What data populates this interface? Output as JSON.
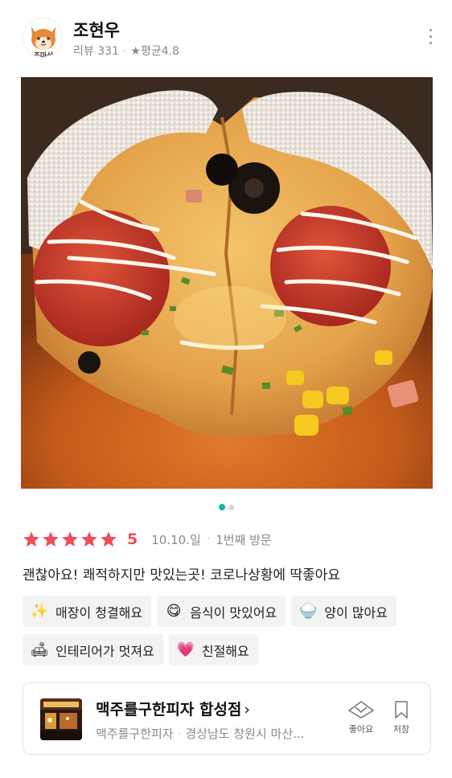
{
  "user": {
    "name": "조현우",
    "avatar_text": "조마산",
    "review_count_label": "리뷰 331",
    "avg_label": "★평균4.8"
  },
  "photo": {
    "pager_total": 2,
    "pager_active": 1
  },
  "review": {
    "stars": 5,
    "score": "5",
    "date": "10.10.일",
    "visit": "1번째 방문",
    "text": "괜찮아요! 쾌적하지만 맛있는곳! 코로나상황에 딱좋아요"
  },
  "tags": [
    {
      "icon": "sparkles-icon",
      "glyph": "✨",
      "label": "매장이 청결해요"
    },
    {
      "icon": "yum-face-icon",
      "glyph": "😋",
      "label": "음식이 맛있어요"
    },
    {
      "icon": "rice-bowl-icon",
      "glyph": "🍚",
      "label": "양이 많아요"
    },
    {
      "icon": "sofa-icon",
      "glyph": "🛋",
      "label": "인테리어가 멋져요"
    },
    {
      "icon": "heart-icon",
      "glyph": "💗",
      "label": "친절해요"
    }
  ],
  "place": {
    "name": "맥주를구한피자 합성점",
    "chevron": "›",
    "category": "맥주를구한피자",
    "address": "경상남도 창원시 마산...",
    "like_label": "좋아요",
    "save_label": "저장"
  },
  "colors": {
    "accent_star": "#ef4d5a",
    "pager_active": "#13b5a6"
  }
}
